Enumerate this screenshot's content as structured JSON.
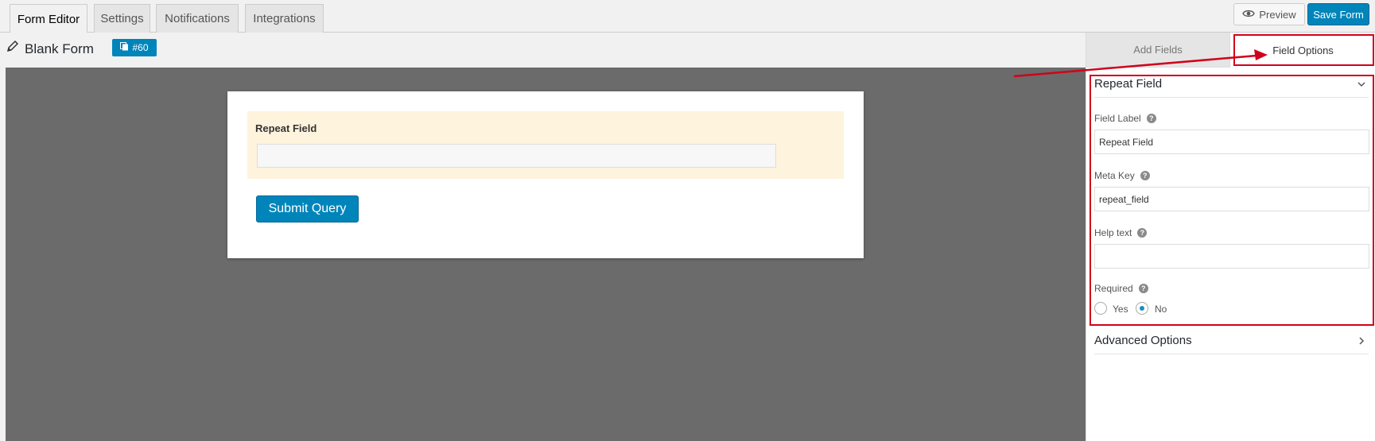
{
  "tabs": [
    {
      "label": "Form Editor",
      "active": true
    },
    {
      "label": "Settings",
      "active": false
    },
    {
      "label": "Notifications",
      "active": false
    },
    {
      "label": "Integrations",
      "active": false
    }
  ],
  "toolbar": {
    "preview_label": "Preview",
    "save_label": "Save Form"
  },
  "form": {
    "title": "Blank Form",
    "id_badge": "#60"
  },
  "canvas": {
    "field_label": "Repeat Field",
    "field_value": "",
    "submit_label": "Submit Query"
  },
  "panel": {
    "tabs": [
      {
        "label": "Add Fields",
        "active": false
      },
      {
        "label": "Field Options",
        "active": true
      }
    ],
    "section_title": "Repeat Field",
    "field_label_label": "Field Label",
    "field_label_value": "Repeat Field",
    "meta_key_label": "Meta Key",
    "meta_key_value": "repeat_field",
    "help_text_label": "Help text",
    "help_text_value": "",
    "required_label": "Required",
    "required_options": [
      "Yes",
      "No"
    ],
    "required_selected": "No",
    "advanced_label": "Advanced Options"
  },
  "colors": {
    "primary": "#0085ba",
    "canvas_bg": "#6b6b6b",
    "field_highlight": "#fef3dc",
    "annotation_red": "#d0021b"
  },
  "icons": [
    "pencil-icon",
    "eye-icon",
    "copy-icon",
    "help-icon",
    "chevron-down-icon",
    "chevron-right-icon"
  ]
}
